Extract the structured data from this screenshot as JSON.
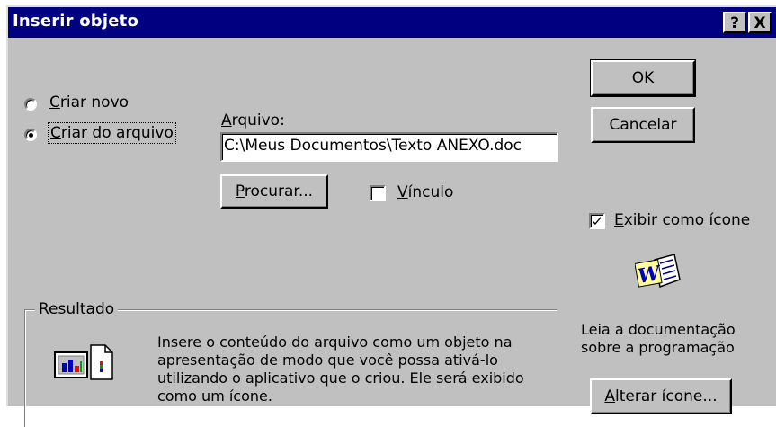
{
  "window": {
    "title": "Inserir objeto",
    "help_glyph": "?",
    "close_glyph": "X"
  },
  "options": {
    "create_new": {
      "label": "Criar novo",
      "selected": false
    },
    "create_from_file": {
      "label": "Criar do arquivo",
      "selected": true
    }
  },
  "file": {
    "label": "Arquivo:",
    "value": "C:\\Meus Documentos\\Texto ANEXO.doc",
    "browse_label": "Procurar...",
    "link_label": "Vínculo",
    "link_checked": false
  },
  "buttons": {
    "ok": "OK",
    "cancel": "Cancelar",
    "change_icon": "Alterar ícone..."
  },
  "display_as_icon": {
    "label": "Exibir como ícone",
    "checked": true
  },
  "icon_caption": "Leia a documentação sobre a programação",
  "result": {
    "label": "Resultado",
    "text": "Insere o conteúdo do arquivo como um objeto na apresentação de modo que você possa ativá-lo utilizando o aplicativo que o criou. Ele será exibido como um ícone."
  },
  "colors": {
    "title_bar": "#000080",
    "dialog_face": "#c0c0c0"
  }
}
